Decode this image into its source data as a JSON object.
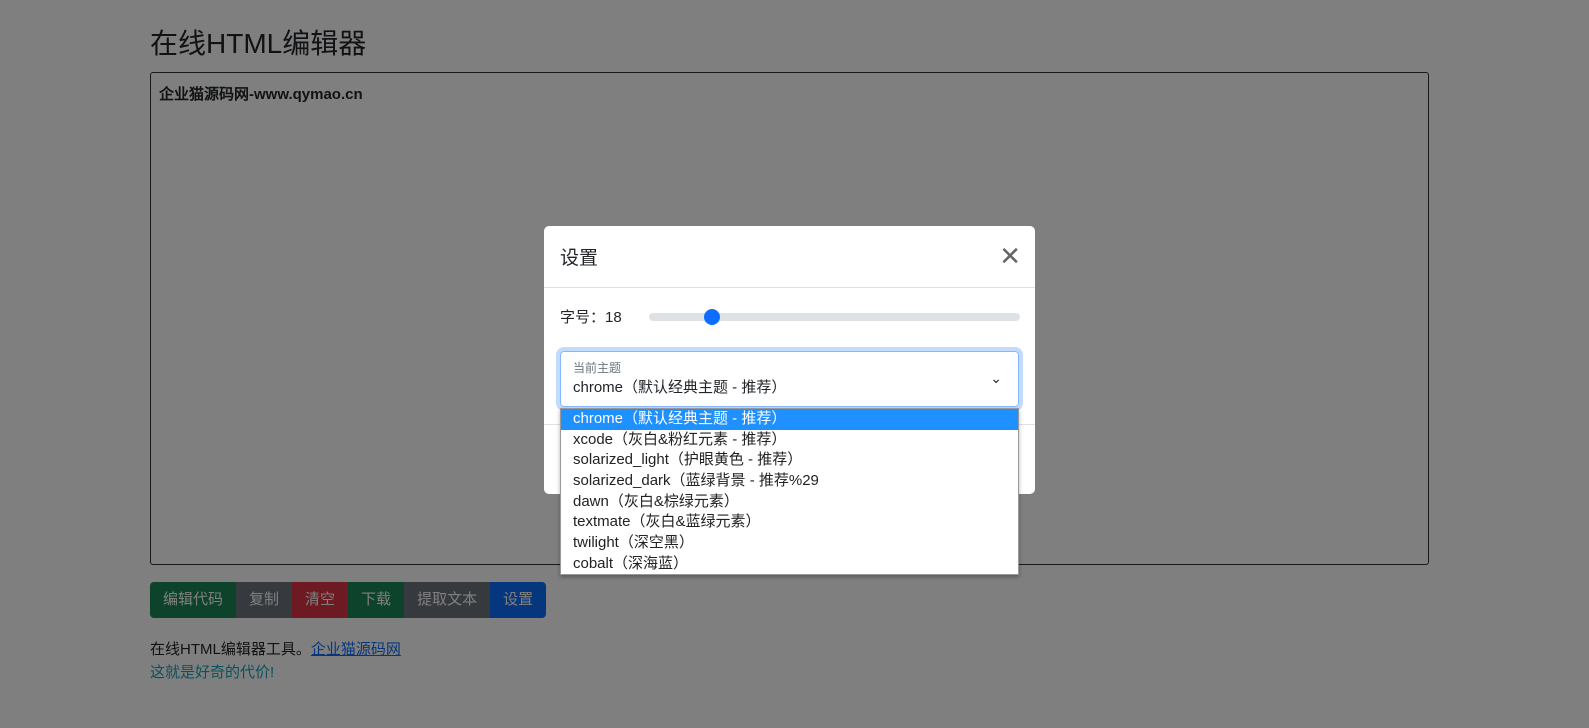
{
  "page": {
    "title": "在线HTML编辑器",
    "editor_content": "企业猫源码网-www.qymao.cn",
    "buttons": [
      {
        "label": "编辑代码",
        "color": "#198754"
      },
      {
        "label": "复制",
        "color": "#6c757d"
      },
      {
        "label": "清空",
        "color": "#dc3545"
      },
      {
        "label": "下载",
        "color": "#198754"
      },
      {
        "label": "提取文本",
        "color": "#6c757d"
      },
      {
        "label": "设置",
        "color": "#0d6efd"
      }
    ],
    "description": "在线HTML编辑器工具。",
    "link": "企业猫源码网",
    "tip": "这就是好奇的代价!"
  },
  "modal": {
    "title": "设置",
    "close_icon": "close-icon",
    "font_size_label": "字号：",
    "font_size": "18",
    "font_size_fraction": 0.17,
    "theme_label": "当前主题",
    "theme_value": "chrome（默认经典主题 - 推荐）",
    "options": [
      "chrome（默认经典主题 - 推荐）",
      "xcode（灰白&粉红元素 - 推荐）",
      "solarized_light（护眼黄色 - 推荐）",
      "solarized_dark（蓝绿背景 - 推荐%29",
      "dawn（灰白&棕绿元素）",
      "textmate（灰白&蓝绿元素）",
      "twilight（深空黑）",
      "cobalt（深海蓝）"
    ]
  }
}
